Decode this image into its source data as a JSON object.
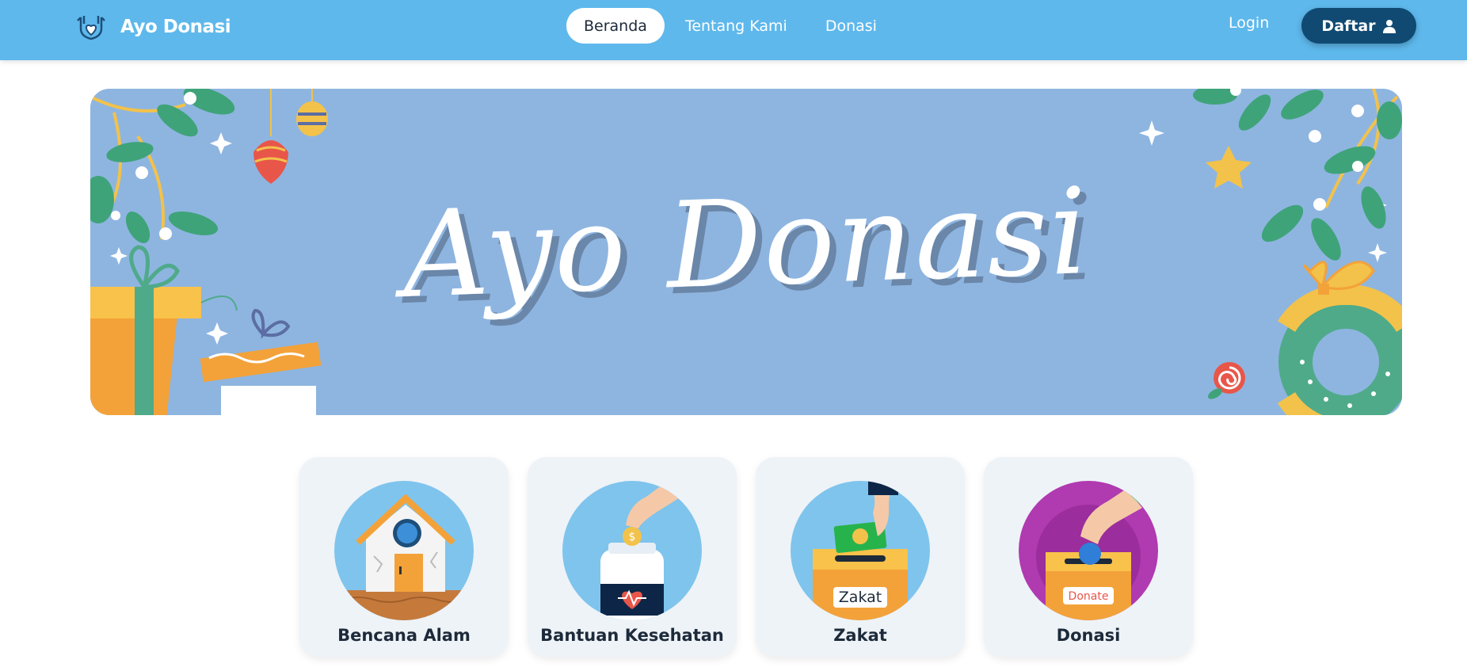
{
  "brand": {
    "name": "Ayo Donasi",
    "icon": "heart-hands-icon"
  },
  "nav": {
    "items": [
      {
        "label": "Beranda",
        "active": true
      },
      {
        "label": "Tentang Kami",
        "active": false
      },
      {
        "label": "Donasi",
        "active": false
      }
    ],
    "login_label": "Login",
    "register_label": "Daftar",
    "register_icon": "user-icon"
  },
  "hero": {
    "title": "Ayo Donasi"
  },
  "categories": [
    {
      "label": "Bencana Alam",
      "icon": "damaged-house-illustration"
    },
    {
      "label": "Bantuan Kesehatan",
      "icon": "health-jar-illustration",
      "jar_text": "$"
    },
    {
      "label": "Zakat",
      "icon": "zakat-box-illustration",
      "box_text": "Zakat"
    },
    {
      "label": "Donasi",
      "icon": "donate-box-illustration",
      "box_text": "Donate"
    }
  ],
  "colors": {
    "navbar": "#5eb8ec",
    "register_button": "#104a72",
    "hero_background": "#8eb5e0",
    "card_background": "#eef3f8"
  }
}
